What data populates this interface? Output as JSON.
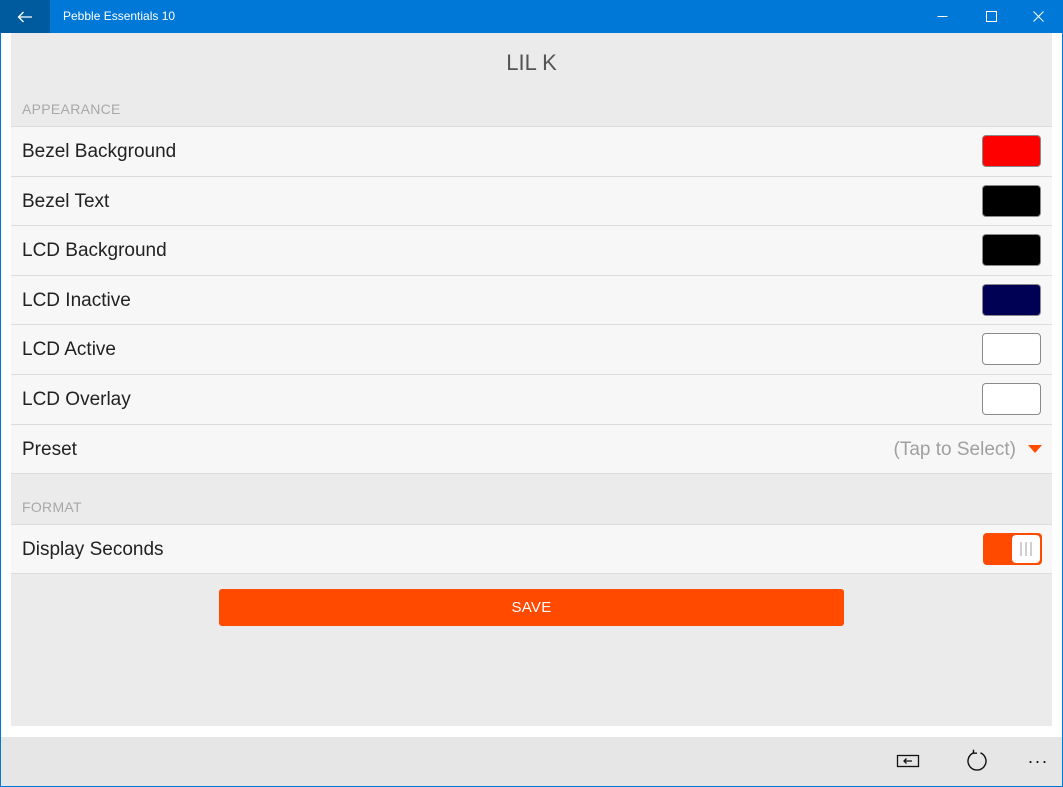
{
  "window": {
    "title": "Pebble Essentials 10",
    "back_icon": "arrow-left-icon",
    "minimize_icon": "minimize-icon",
    "maximize_icon": "maximize-icon",
    "close_icon": "close-icon",
    "accent": "#0078d7"
  },
  "page": {
    "title": "LIL K"
  },
  "appearance": {
    "header": "APPEARANCE",
    "rows": [
      {
        "label": "Bezel Background",
        "color": "#ff0000"
      },
      {
        "label": "Bezel Text",
        "color": "#000000"
      },
      {
        "label": "LCD Background",
        "color": "#000000"
      },
      {
        "label": "LCD Inactive",
        "color": "#000055"
      },
      {
        "label": "LCD Active",
        "color": "#ffffff"
      },
      {
        "label": "LCD Overlay",
        "color": "#ffffff"
      }
    ],
    "preset": {
      "label": "Preset",
      "value": "(Tap to Select)",
      "icon": "caret-down-icon"
    }
  },
  "format": {
    "header": "FORMAT",
    "display_seconds": {
      "label": "Display Seconds",
      "on": true
    }
  },
  "actions": {
    "save_label": "SAVE",
    "save_color": "#ff4a00"
  },
  "command_bar": {
    "icons": [
      "keyboard-icon",
      "refresh-icon",
      "more-icon"
    ],
    "more_label": "···"
  }
}
